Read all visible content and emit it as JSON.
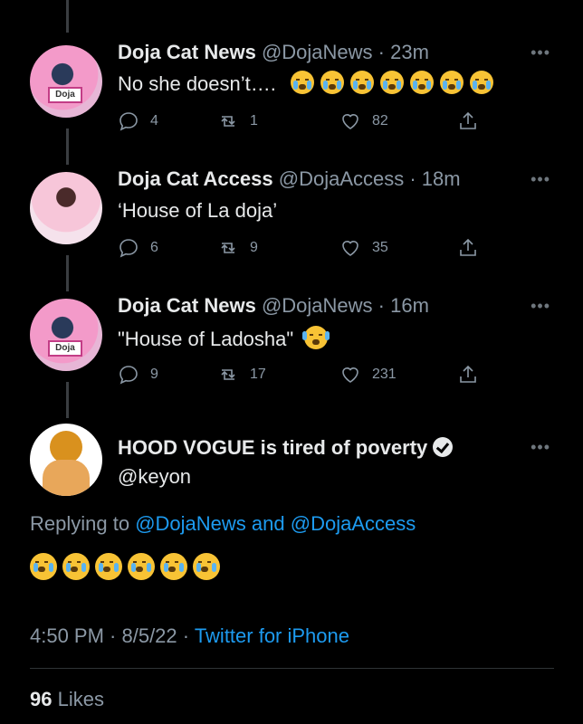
{
  "tweets": [
    {
      "name": "Doja Cat News",
      "handle": "@DojaNews · 23m",
      "text": "No she doesn’t….",
      "emoji_count": 7,
      "replies": "4",
      "retweets": "1",
      "likes": "82",
      "avatar": "doja-news-avatar"
    },
    {
      "name": "Doja Cat Access",
      "handle": "@DojaAccess · 18m",
      "text": "‘House of La doja’",
      "emoji_count": 0,
      "replies": "6",
      "retweets": "9",
      "likes": "35",
      "avatar": "doja-access-avatar"
    },
    {
      "name": "Doja Cat News",
      "handle": "@DojaNews · 16m",
      "text": "\"House of Ladosha\"",
      "emoji_count": 1,
      "replies": "9",
      "retweets": "17",
      "likes": "231",
      "avatar": "doja-news-avatar"
    }
  ],
  "main_tweet": {
    "name": "HOOD VOGUE is tired of poverty",
    "handle": "@keyon",
    "replying_prefix": "Replying to",
    "replying_user1": "@DojaNews",
    "replying_and": "and",
    "replying_user2": "@DojaAccess",
    "emoji_count": 6,
    "time": "4:50 PM · 8/5/22 ·",
    "source": "Twitter for iPhone",
    "likes_count": "96",
    "likes_label": "Likes"
  },
  "icons": {
    "reply": "reply-icon",
    "retweet": "retweet-icon",
    "like": "heart-icon",
    "share": "share-icon",
    "more": "more-icon",
    "verified": "verified-badge-icon"
  },
  "colors": {
    "background": "#000000",
    "text": "#e7e9ea",
    "secondary": "#8b98a5",
    "link": "#1d9bf0"
  }
}
